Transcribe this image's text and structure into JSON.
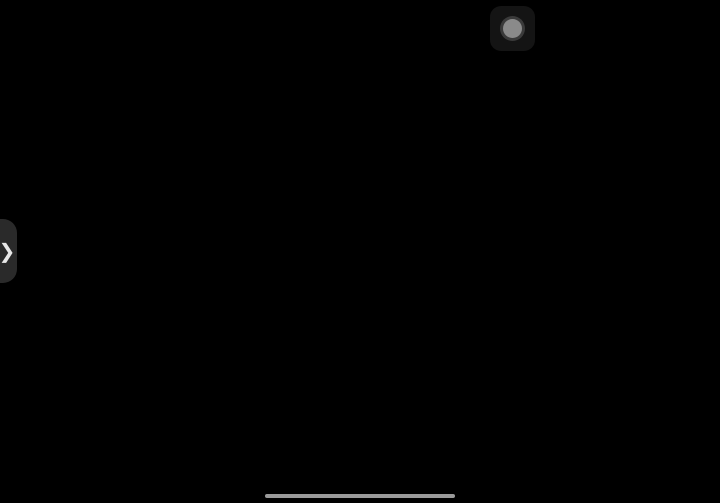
{
  "screen": {
    "background": "#000000"
  },
  "assistive_touch": {
    "icon": "assistive-touch-icon",
    "color_outer": "#141414",
    "color_core": "#8a8a8a"
  },
  "side_handle": {
    "icon": "chevron-right-icon",
    "glyph": "❯"
  },
  "home_indicator": {
    "color": "#9a9a9a"
  }
}
